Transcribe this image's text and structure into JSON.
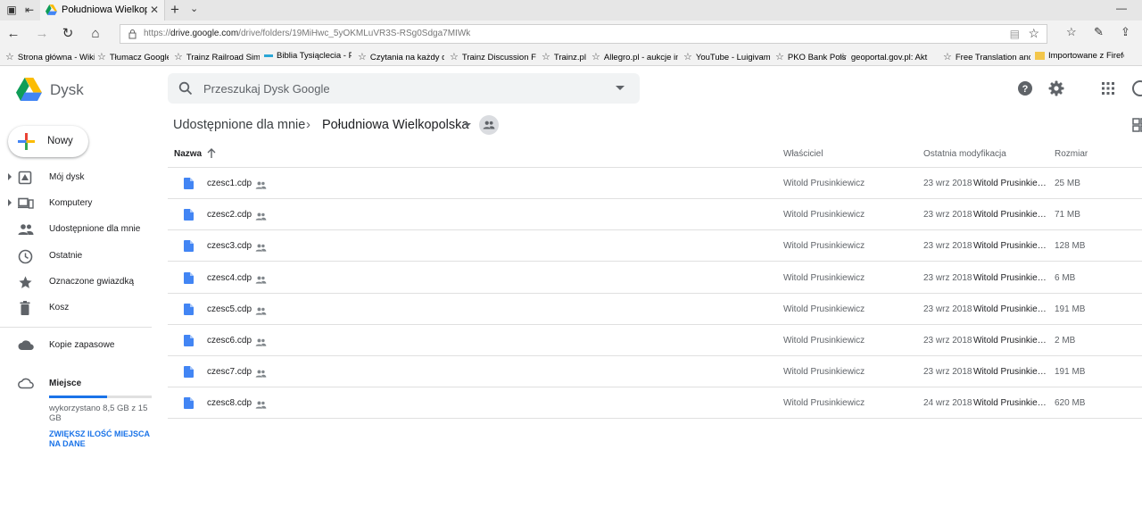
{
  "browser": {
    "tab_title": "Południowa Wielkopols",
    "url_prefix": "https://",
    "url_host": "drive.google.com",
    "url_path": "/drive/folders/19MiHwc_5yOKMLuVR3S-RSg0Sdga7MIWk",
    "favorites": [
      "Strona główna - Wiki",
      "Tłumacz Google",
      "Trainz Railroad Simul",
      "Biblia Tysiąclecia - Pis",
      "Czytania na każdy dzi",
      "Trainz Discussion For",
      "Trainz.pl",
      "Allegro.pl - aukcje int",
      "YouTube - Luigivamp",
      "PKO Bank Polski",
      "geoportal.gov.pl: Akt",
      "Free Translation and I",
      "Importowane z Firefo"
    ]
  },
  "app": {
    "name": "Dysk",
    "search_placeholder": "Przeszukaj Dysk Google"
  },
  "sidebar": {
    "new_label": "Nowy",
    "items": [
      {
        "label": "Mój dysk",
        "icon": "my-drive-icon"
      },
      {
        "label": "Komputery",
        "icon": "computers-icon"
      },
      {
        "label": "Udostępnione dla mnie",
        "icon": "shared-icon"
      },
      {
        "label": "Ostatnie",
        "icon": "clock-icon"
      },
      {
        "label": "Oznaczone gwiazdką",
        "icon": "star-icon"
      },
      {
        "label": "Kosz",
        "icon": "trash-icon"
      },
      {
        "label": "Kopie zapasowe",
        "icon": "cloud-icon"
      }
    ],
    "storage": {
      "label": "Miejsce",
      "used_text": "wykorzystano 8,5 GB z 15 GB",
      "used_fraction": 0.567,
      "upgrade": "ZWIĘKSZ ILOŚĆ MIEJSCA NA DANE"
    }
  },
  "breadcrumb": {
    "parent": "Udostępnione dla mnie",
    "separator": "›",
    "current": "Południowa Wielkopolska"
  },
  "table": {
    "headers": {
      "name": "Nazwa",
      "owner": "Właściciel",
      "modified": "Ostatnia modyfikacja",
      "size": "Rozmiar"
    },
    "rows": [
      {
        "name": "czesc1.cdp",
        "owner": "Witold Prusinkiewicz",
        "date": "23 wrz 2018",
        "by": "Witold Prusinkiew...",
        "size": "25 MB"
      },
      {
        "name": "czesc2.cdp",
        "owner": "Witold Prusinkiewicz",
        "date": "23 wrz 2018",
        "by": "Witold Prusinkiew...",
        "size": "71 MB"
      },
      {
        "name": "czesc3.cdp",
        "owner": "Witold Prusinkiewicz",
        "date": "23 wrz 2018",
        "by": "Witold Prusinkiew...",
        "size": "128 MB"
      },
      {
        "name": "czesc4.cdp",
        "owner": "Witold Prusinkiewicz",
        "date": "23 wrz 2018",
        "by": "Witold Prusinkiew...",
        "size": "6 MB"
      },
      {
        "name": "czesc5.cdp",
        "owner": "Witold Prusinkiewicz",
        "date": "23 wrz 2018",
        "by": "Witold Prusinkiew...",
        "size": "191 MB"
      },
      {
        "name": "czesc6.cdp",
        "owner": "Witold Prusinkiewicz",
        "date": "23 wrz 2018",
        "by": "Witold Prusinkiew...",
        "size": "2 MB"
      },
      {
        "name": "czesc7.cdp",
        "owner": "Witold Prusinkiewicz",
        "date": "23 wrz 2018",
        "by": "Witold Prusinkiew...",
        "size": "191 MB"
      },
      {
        "name": "czesc8.cdp",
        "owner": "Witold Prusinkiewicz",
        "date": "24 wrz 2018",
        "by": "Witold Prusinkiew...",
        "size": "620 MB"
      }
    ]
  },
  "colors": {
    "accent": "#1a73e8",
    "doc_icon": "#4285f4",
    "text_muted": "#5f6368"
  }
}
